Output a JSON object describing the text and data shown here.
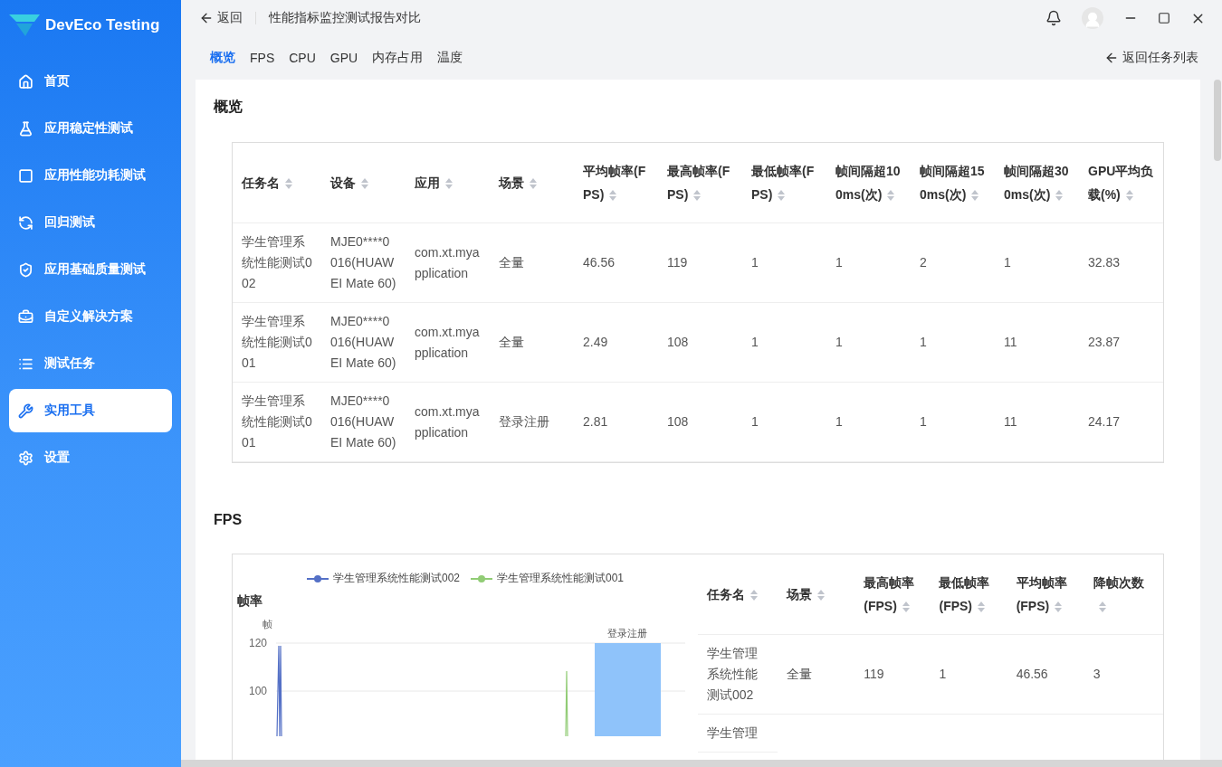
{
  "app": {
    "name": "DevEco Testing"
  },
  "sidebar": {
    "items": [
      {
        "label": "首页",
        "selected": false
      },
      {
        "label": "应用稳定性测试",
        "selected": false
      },
      {
        "label": "应用性能功耗测试",
        "selected": false
      },
      {
        "label": "回归测试",
        "selected": false
      },
      {
        "label": "应用基础质量测试",
        "selected": false
      },
      {
        "label": "自定义解决方案",
        "selected": false
      },
      {
        "label": "测试任务",
        "selected": false
      },
      {
        "label": "实用工具",
        "selected": true
      },
      {
        "label": "设置",
        "selected": false
      }
    ]
  },
  "header": {
    "back": "返回",
    "title": "性能指标监控测试报告对比"
  },
  "tabs": [
    {
      "label": "概览",
      "selected": true
    },
    {
      "label": "FPS",
      "selected": false
    },
    {
      "label": "CPU",
      "selected": false
    },
    {
      "label": "GPU",
      "selected": false
    },
    {
      "label": "内存占用",
      "selected": false
    },
    {
      "label": "温度",
      "selected": false
    }
  ],
  "back_to_list": "返回任务列表",
  "overview": {
    "title": "概览",
    "columns": [
      "任务名",
      "设备",
      "应用",
      "场景",
      "平均帧率(FPS)",
      "最高帧率(FPS)",
      "最低帧率(FPS)",
      "帧间隔超100ms(次)",
      "帧间隔超150ms(次)",
      "帧间隔超300ms(次)",
      "GPU平均负载(%)"
    ],
    "rows": [
      [
        "学生管理系统性能测试002",
        "MJE0****0016(HUAWEI Mate 60)",
        "com.xt.myapplication",
        "全量",
        "46.56",
        "119",
        "1",
        "1",
        "2",
        "1",
        "32.83"
      ],
      [
        "学生管理系统性能测试001",
        "MJE0****0016(HUAWEI Mate 60)",
        "com.xt.myapplication",
        "全量",
        "2.49",
        "108",
        "1",
        "1",
        "1",
        "11",
        "23.87"
      ],
      [
        "学生管理系统性能测试001",
        "MJE0****0016(HUAWEI Mate 60)",
        "com.xt.myapplication",
        "登录注册",
        "2.81",
        "108",
        "1",
        "1",
        "1",
        "11",
        "24.17"
      ]
    ]
  },
  "fps": {
    "title": "FPS",
    "chart": {
      "title": "帧率",
      "unit": "帧",
      "ticks": [
        "120",
        "100"
      ],
      "legend": [
        {
          "name": "学生管理系统性能测试002",
          "color": "#5470c6"
        },
        {
          "name": "学生管理系统性能测试001",
          "color": "#91cc75"
        }
      ],
      "scene_label": "登录注册"
    },
    "table": {
      "columns": [
        "任务名",
        "场景",
        "最高帧率(FPS)",
        "最低帧率(FPS)",
        "平均帧率(FPS)",
        "降帧次数"
      ],
      "rows": [
        [
          "学生管理系统性能测试002",
          "全量",
          "119",
          "1",
          "46.56",
          "3"
        ],
        [
          "学生管理"
        ]
      ]
    }
  }
}
